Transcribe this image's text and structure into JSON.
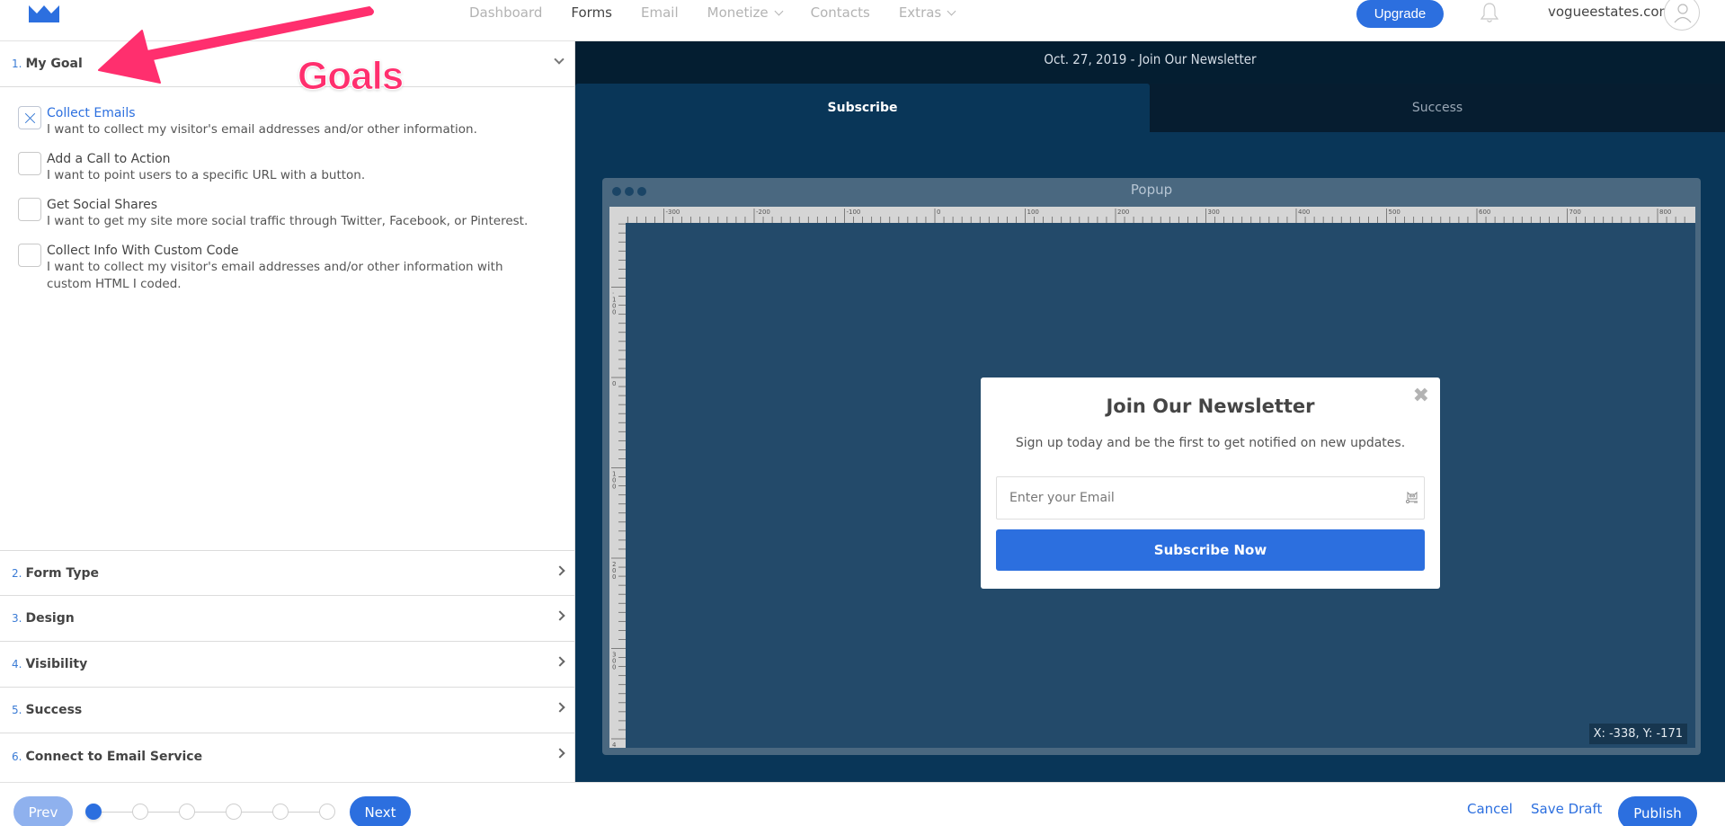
{
  "topbar": {
    "logo": "crown-logo",
    "nav": [
      {
        "label": "Dashboard",
        "active": false,
        "dropdown": false
      },
      {
        "label": "Forms",
        "active": true,
        "dropdown": false
      },
      {
        "label": "Email",
        "active": false,
        "dropdown": false
      },
      {
        "label": "Monetize",
        "active": false,
        "dropdown": true
      },
      {
        "label": "Contacts",
        "active": false,
        "dropdown": false
      },
      {
        "label": "Extras",
        "active": false,
        "dropdown": true
      }
    ],
    "upgrade_label": "Upgrade",
    "account_label": "vogueestates.com",
    "icons": {
      "bell": "bell-icon",
      "avatar": "user-avatar-icon"
    }
  },
  "annotation": {
    "text": "Goals",
    "color": "#ff2f6e"
  },
  "left_panel": {
    "sections": [
      {
        "num": "1.",
        "label": "My Goal",
        "expanded": true
      },
      {
        "num": "2.",
        "label": "Form Type",
        "expanded": false
      },
      {
        "num": "3.",
        "label": "Design",
        "expanded": false
      },
      {
        "num": "4.",
        "label": "Visibility",
        "expanded": false
      },
      {
        "num": "5.",
        "label": "Success",
        "expanded": false
      },
      {
        "num": "6.",
        "label": "Connect to Email Service",
        "expanded": false
      }
    ],
    "goals": [
      {
        "title": "Collect Emails",
        "desc": "I want to collect my visitor's email addresses and/or other information.",
        "selected": true
      },
      {
        "title": "Add a Call to Action",
        "desc": "I want to point users to a specific URL with a button.",
        "selected": false
      },
      {
        "title": "Get Social Shares",
        "desc": "I want to get my site more social traffic through Twitter, Facebook, or Pinterest.",
        "selected": false
      },
      {
        "title": "Collect Info With Custom Code",
        "desc": "I want to collect my visitor's email addresses and/or other information with custom HTML I coded.",
        "selected": false
      }
    ]
  },
  "preview": {
    "title": "Oct. 27, 2019 - Join Our Newsletter",
    "tabs": [
      {
        "label": "Subscribe",
        "active": true
      },
      {
        "label": "Success",
        "active": false
      }
    ],
    "window_title": "Popup",
    "ruler_top_labels": [
      "-300",
      "-200",
      "-100",
      "0",
      "100",
      "200",
      "300",
      "400",
      "500",
      "600",
      "700",
      "800"
    ],
    "ruler_left_labels": [
      "-100",
      "0",
      "100",
      "200",
      "300",
      "4"
    ],
    "coords": "X: -338, Y: -171",
    "popup": {
      "title": "Join Our Newsletter",
      "subtitle": "Sign up today and be the first to get notified on new updates.",
      "email_placeholder": "Enter your Email",
      "email_value": "",
      "button_label": "Subscribe Now",
      "close_icon": "close-icon"
    }
  },
  "bottombar": {
    "prev_label": "Prev",
    "next_label": "Next",
    "steps_total": 6,
    "current_step": 1,
    "cancel_label": "Cancel",
    "save_draft_label": "Save Draft",
    "publish_label": "Publish"
  },
  "colors": {
    "accent": "#2c6fdf",
    "preview_bg": "#093658",
    "canvas_bg": "#234a6a",
    "annotation": "#ff2f6e"
  }
}
